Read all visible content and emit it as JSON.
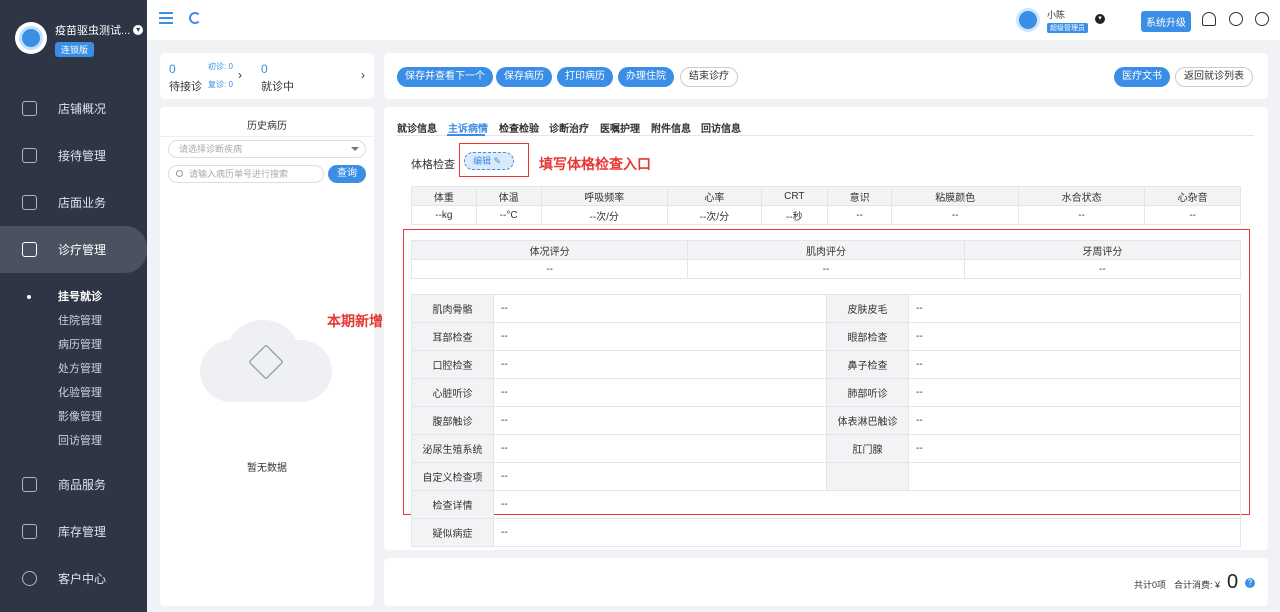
{
  "brand": {
    "name": "疫苗驱虫测试...",
    "tag": "连锁版"
  },
  "sidebar": {
    "items": [
      {
        "label": "店铺概况"
      },
      {
        "label": "接待管理"
      },
      {
        "label": "店面业务"
      },
      {
        "label": "诊疗管理"
      },
      {
        "label": "商品服务"
      },
      {
        "label": "库存管理"
      },
      {
        "label": "客户中心"
      }
    ],
    "subitems": [
      {
        "label": "挂号就诊"
      },
      {
        "label": "住院管理"
      },
      {
        "label": "病历管理"
      },
      {
        "label": "处方管理"
      },
      {
        "label": "化验管理"
      },
      {
        "label": "影像管理"
      },
      {
        "label": "回访管理"
      }
    ]
  },
  "topbar": {
    "user_name": "小陈",
    "user_role": "超级管理员",
    "upgrade": "系统升级"
  },
  "stats": {
    "waiting_count": "0",
    "waiting_label": "待接诊",
    "first_visit": "初诊: 0",
    "re_visit": "复诊: 0",
    "in_progress_count": "0",
    "in_progress_label": "就诊中"
  },
  "history": {
    "title": "历史病历",
    "diagnosis_placeholder": "请选择诊断疾病",
    "search_placeholder": "请输入病历单号进行搜索",
    "query_label": "查询",
    "empty_text": "暂无数据"
  },
  "toolbar": {
    "save_next": "保存并查看下一个",
    "save_record": "保存病历",
    "print_record": "打印病历",
    "admit": "办理住院",
    "finish": "结束诊疗",
    "medical_doc": "医疗文书",
    "back_list": "返回就诊列表"
  },
  "tabs": [
    "就诊信息",
    "主诉病情",
    "检查检验",
    "诊断治疗",
    "医嘱护理",
    "附件信息",
    "回访信息"
  ],
  "exam": {
    "label": "体格检查",
    "edit_label": "编辑",
    "vitals_headers": [
      "体重",
      "体温",
      "呼吸频率",
      "心率",
      "CRT",
      "意识",
      "粘膜颜色",
      "水合状态",
      "心杂音"
    ],
    "vitals_values": [
      "--kg",
      "--°C",
      "--次/分",
      "--次/分",
      "--秒",
      "--",
      "--",
      "--",
      "--"
    ],
    "score_headers": [
      "体况评分",
      "肌肉评分",
      "牙周评分"
    ],
    "score_values": [
      "--",
      "--",
      "--"
    ],
    "rows": [
      {
        "k1": "肌肉骨骼",
        "v1": "--",
        "k2": "皮肤皮毛",
        "v2": "--"
      },
      {
        "k1": "耳部检查",
        "v1": "--",
        "k2": "眼部检查",
        "v2": "--"
      },
      {
        "k1": "口腔检查",
        "v1": "--",
        "k2": "鼻子检查",
        "v2": "--"
      },
      {
        "k1": "心脏听诊",
        "v1": "--",
        "k2": "肺部听诊",
        "v2": "--"
      },
      {
        "k1": "腹部触诊",
        "v1": "--",
        "k2": "体表淋巴触诊",
        "v2": "--"
      },
      {
        "k1": "泌尿生殖系统",
        "v1": "--",
        "k2": "肛门腺",
        "v2": "--"
      },
      {
        "k1": "自定义检查项",
        "v1": "--",
        "k2": "",
        "v2": ""
      }
    ],
    "detail_label": "检查详情",
    "detail_value": "--",
    "suspected_label": "疑似病症",
    "suspected_value": "--"
  },
  "annotations": {
    "entry": "填写体格检查入口",
    "new": "本期新增",
    "color": "#e53935"
  },
  "summary": {
    "total": "共计0项",
    "consume_label": "合计消费: ¥",
    "consume_value": "0"
  },
  "colors": {
    "accent": "#3a8ee6",
    "sidebar": "#2e3544"
  }
}
